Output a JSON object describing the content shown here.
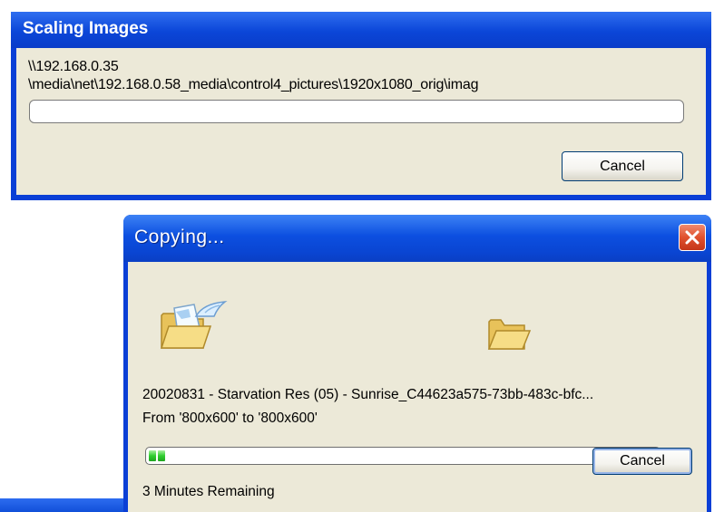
{
  "scaling_dialog": {
    "title": "Scaling Images",
    "path_line1": "\\\\192.168.0.35",
    "path_line2": "\\media\\net\\192.168.0.58_media\\control4_pictures\\1920x1080_orig\\imag",
    "progress": 0,
    "cancel_label": "Cancel"
  },
  "copy_dialog": {
    "title": "Copying...",
    "close_icon": "close-icon",
    "source_icon": "open-folder-with-document-icon",
    "flying_icon": "flying-paper-icon",
    "dest_icon": "open-folder-icon",
    "filename": "20020831 - Starvation Res (05) - Sunrise_C44623a575-73bb-483c-bfc...",
    "from_to": "From '800x600' to '800x600'",
    "progress": 0.05,
    "cancel_label": "Cancel",
    "remaining": "3 Minutes Remaining"
  },
  "colors": {
    "xp_title_blue": "#0a45d2",
    "dialog_bg": "#ece9d8",
    "progress_green": "#2fcd2f",
    "close_red": "#e0512e"
  }
}
